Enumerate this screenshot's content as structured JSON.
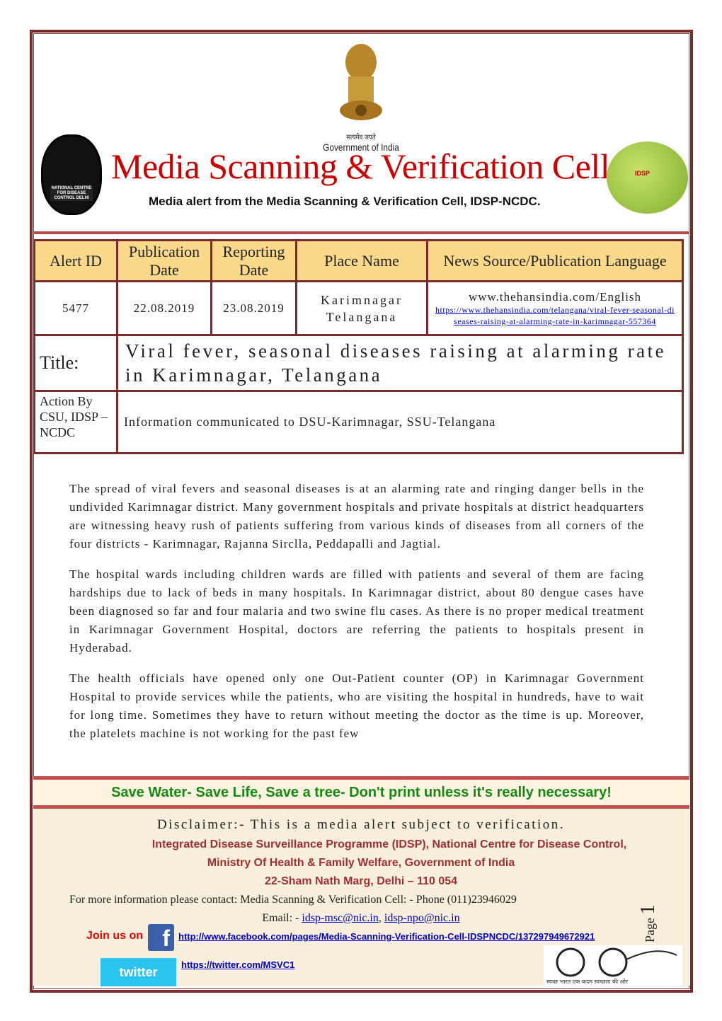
{
  "header": {
    "emblem_caption_hindi": "सत्यमेव जयते",
    "emblem_caption": "Government of India",
    "title": "Media Scanning & Verification Cell",
    "subtitle": "Media alert from the Media Scanning & Verification Cell, IDSP-NCDC.",
    "left_logo_text": "NATIONAL CENTRE FOR DISEASE CONTROL DELHI",
    "right_logo_text": "IDSP"
  },
  "table": {
    "headers": [
      "Alert  ID",
      "Publication Date",
      "Reporting Date",
      "Place Name",
      "News Source/Publication Language"
    ],
    "row": {
      "alert_id": "5477",
      "publication_date": "22.08.2019",
      "reporting_date": "23.08.2019",
      "place_line1": "Karimnagar",
      "place_line2": "Telangana",
      "source": "www.thehansindia.com/English",
      "source_url": "https://www.thehansindia.com/telangana/viral-fever-seasonal-diseases-raising-at-alarming-rate-in-karimnagar-557364"
    },
    "title_label": "Title:",
    "title": "Viral fever, seasonal diseases raising at alarming rate in Karimnagar, Telangana",
    "action_label": "Action By CSU, IDSP –NCDC",
    "action": "Information communicated to DSU-Karimnagar, SSU-Telangana"
  },
  "body": [
    "The spread of viral fevers and seasonal diseases is at an alarming rate and ringing danger bells in the undivided Karimnagar district. Many government hospitals and private hospitals at district headquarters are witnessing heavy rush of patients suffering from various kinds of diseases from all corners of the four districts - Karimnagar, Rajanna Sirclla, Peddapalli and Jagtial.",
    "The hospital wards including children wards are filled with patients and several of them are facing hardships due to lack of beds in many hospitals. In Karimnagar district, about 80 dengue cases have been diagnosed so far and four malaria and two swine flu cases. As there is no proper medical treatment in Karimnagar Government Hospital, doctors are referring the patients to hospitals present in Hyderabad.",
    "The health officials have opened only one Out-Patient counter (OP) in Karimnagar Government Hospital to provide services while the patients, who are visiting the hospital in hundreds, have to wait for long time. Sometimes they have to return without meeting the doctor as the time is up. Moreover, the platelets machine is not working for the past few"
  ],
  "banner": "Save Water- Save Life, Save a tree- Don't print unless it's really necessary!",
  "footer": {
    "disclaimer": "Disclaimer:- This is a media alert subject to verification.",
    "org1": "Integrated Disease Surveillance Programme (IDSP), National Centre for Disease Control,",
    "org2": "Ministry Of Health & Family Welfare, Government of India",
    "address": "22-Sham Nath Marg, Delhi – 110 054",
    "contact": "For more information please contact: Media Scanning & Verification Cell: - Phone (011)23946029",
    "email_label": "Email: - ",
    "email1": "idsp-msc@nic.in",
    "email2": "idsp-npo@nic.in",
    "join": "Join us on",
    "facebook_url": "http://www.facebook.com/pages/Media-Scanning-Verification-Cell-IDSPNCDC/137297949672921",
    "twitter_logo": "twitter",
    "twitter_url": "https://twitter.com/MSVC1",
    "page_label": "Page",
    "page_number": "1",
    "swachh_text": "स्वच्छ भारत एक कदम स्वच्छता की ओर"
  },
  "colors": {
    "title_red": "#cc0000",
    "border": "#7b2b2b",
    "header_fill": "#fbd98a",
    "banner_green": "#138a13",
    "org_red": "#a03030"
  }
}
